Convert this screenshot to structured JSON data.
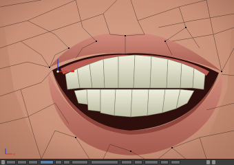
{
  "window": {
    "title": ""
  },
  "viewport": {
    "object": "face mesh",
    "mode": "edit",
    "overlay": "wireframe",
    "axis_labels": {
      "x": "x",
      "z": "z"
    }
  },
  "header": {
    "buttons": [
      "view-menu",
      "select-menu",
      "mesh-menu",
      "mode-select",
      "shading-select",
      "pivot-select",
      "manipulator",
      "layer-buttons",
      "snap",
      "render-icons"
    ]
  },
  "colors": {
    "skin": "#d09a82",
    "skin_shadow": "#a9735e",
    "lip": "#c6786a",
    "lip_inner": "#8e463c",
    "mouth_cavity": "#2f0f0c",
    "teeth": "#d9d9c2",
    "gum": "#b85b52",
    "wire": "#2a201a",
    "ui_bar": "#3c3c3c",
    "selection_accent": "#5f7fae",
    "axis_red": "#d4331e",
    "axis_blue": "#1f3fe0"
  }
}
